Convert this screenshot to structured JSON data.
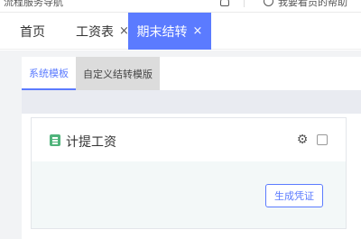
{
  "topbar": {
    "left_text": "流程服务导航",
    "right_text": "我要看员的帮助"
  },
  "tabs": [
    {
      "label": "首页"
    },
    {
      "label": "工资表",
      "close": "×"
    },
    {
      "label": "期末结转",
      "close": "×"
    }
  ],
  "subtabs": [
    {
      "label": "系统模板"
    },
    {
      "label": "自定义结转模版"
    }
  ],
  "card": {
    "title": "计提工资",
    "button_label": "生成凭证"
  },
  "colors": {
    "accent": "#5b7bff",
    "icon_green": "#4fb37a",
    "card_body_bg": "#f3f8f8"
  }
}
